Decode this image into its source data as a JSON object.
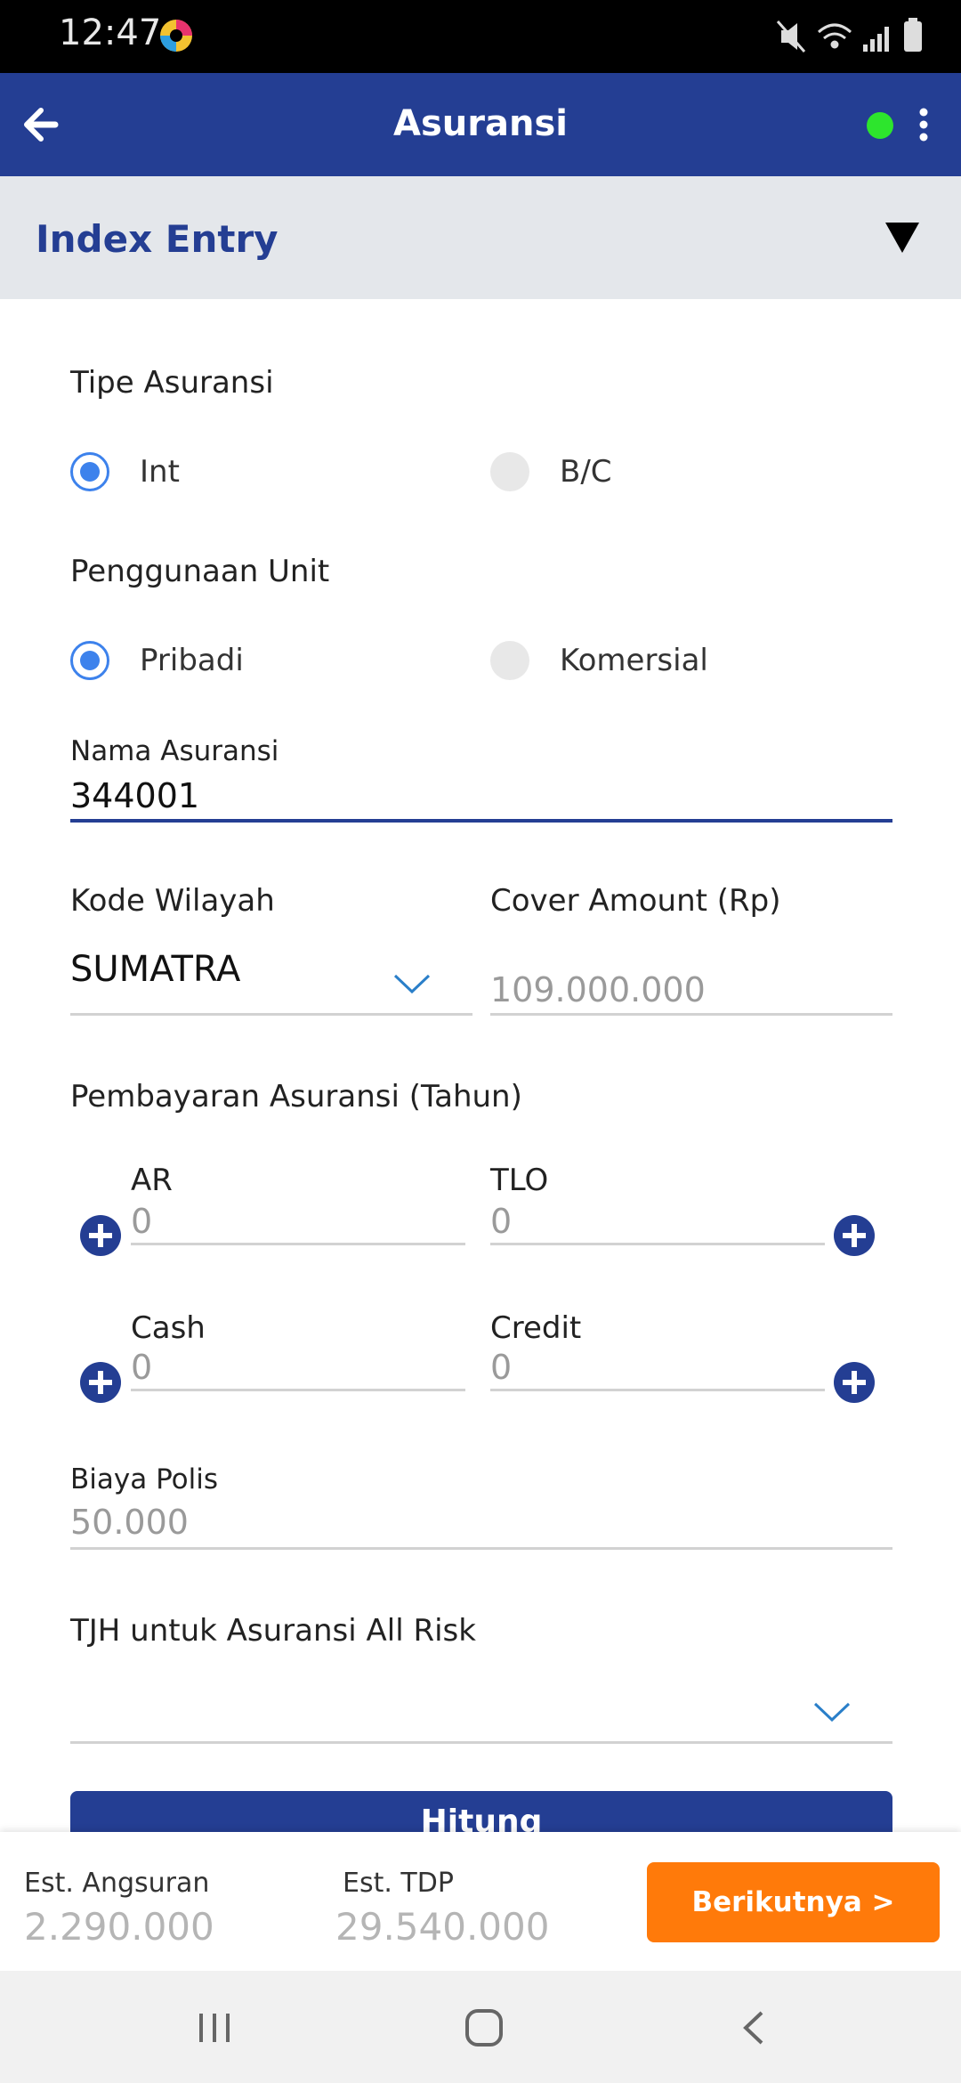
{
  "status_bar": {
    "time": "12:47"
  },
  "header": {
    "title": "Asuransi",
    "online_color": "#2de52d"
  },
  "section": {
    "label": "Index Entry"
  },
  "form": {
    "tipe_asuransi": {
      "label": "Tipe Asuransi",
      "options": [
        "Int",
        "B/C"
      ],
      "selected": "Int"
    },
    "penggunaan_unit": {
      "label": "Penggunaan Unit",
      "options": [
        "Pribadi",
        "Komersial"
      ],
      "selected": "Pribadi"
    },
    "nama_asuransi": {
      "label": "Nama Asuransi",
      "value": "344001"
    },
    "kode_wilayah": {
      "label": "Kode Wilayah",
      "value": "SUMATRA"
    },
    "cover_amount": {
      "label": "Cover Amount (Rp)",
      "value": "109.000.000"
    },
    "pembayaran": {
      "label": "Pembayaran Asuransi (Tahun)",
      "ar": {
        "label": "AR",
        "value": "0"
      },
      "tlo": {
        "label": "TLO",
        "value": "0"
      },
      "cash": {
        "label": "Cash",
        "value": "0"
      },
      "credit": {
        "label": "Credit",
        "value": "0"
      }
    },
    "biaya_polis": {
      "label": "Biaya Polis",
      "value": "50.000"
    },
    "tjh": {
      "label": "TJH untuk Asuransi All Risk",
      "value": ""
    },
    "hitung_label": "Hitung"
  },
  "summary": {
    "angsuran_label": "Est. Angsuran",
    "angsuran_value": "2.290.000",
    "tdp_label": "Est. TDP",
    "tdp_value": "29.540.000",
    "next_label": "Berikutnya >"
  },
  "colors": {
    "primary": "#243e93",
    "accent": "#ff7a0a",
    "radio": "#3d82ec"
  }
}
